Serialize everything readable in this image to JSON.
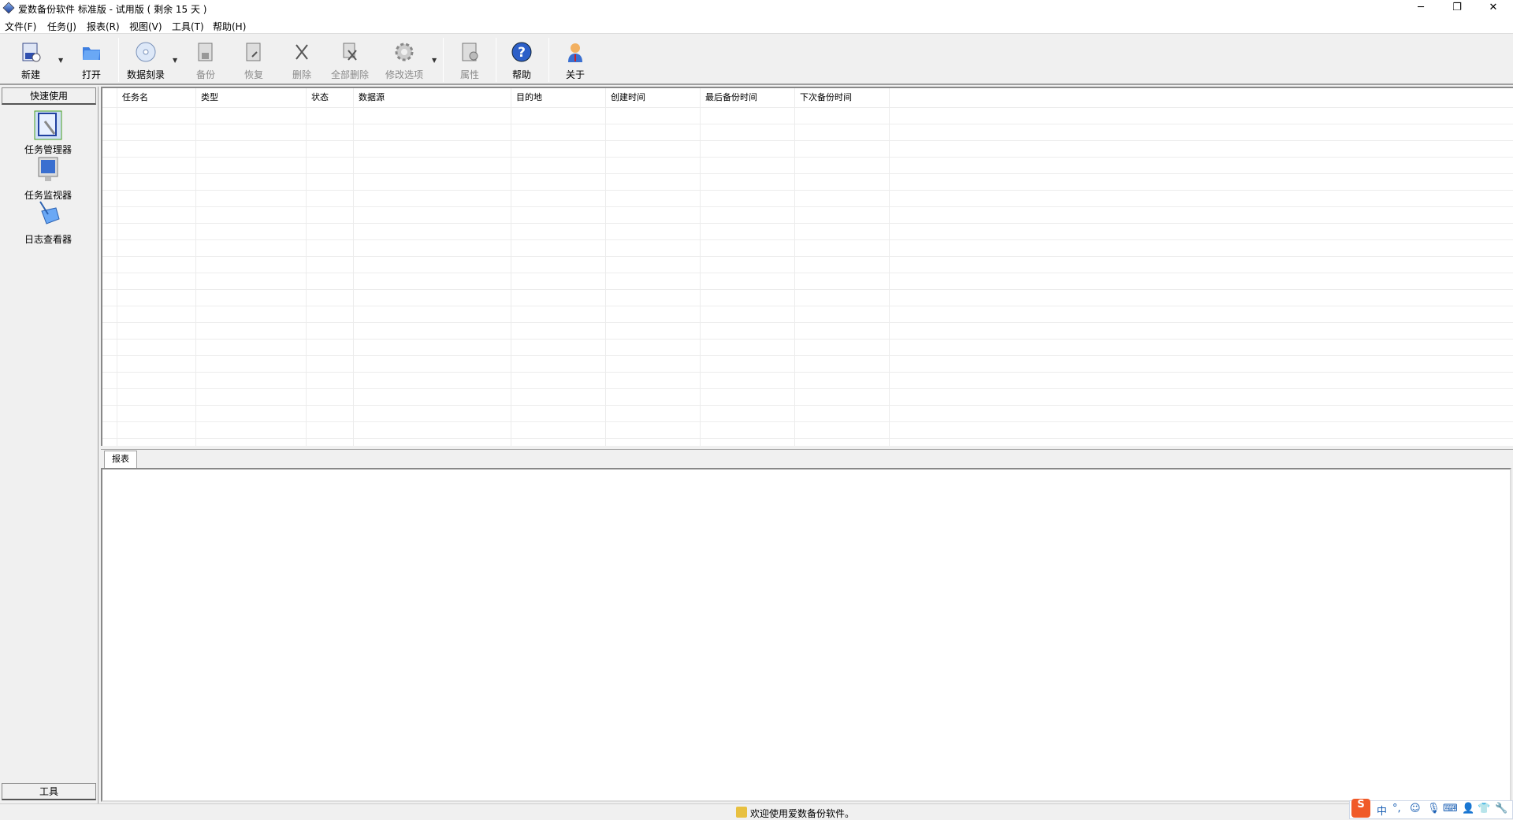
{
  "window": {
    "title": "爱数备份软件 标准版 - 试用版 ( 剩余 15 天 )",
    "controls": {
      "minimize": "─",
      "restore": "❐",
      "close": "✕"
    }
  },
  "menu": [
    "文件(F)",
    "任务(J)",
    "报表(R)",
    "视图(V)",
    "工具(T)",
    "帮助(H)"
  ],
  "toolbar": {
    "new": "新建",
    "open": "打开",
    "burn": "数据刻录",
    "backup": "备份",
    "restore": "恢复",
    "delete": "删除",
    "delete_all": "全部删除",
    "modify_options": "修改选项",
    "properties": "属性",
    "help": "帮助",
    "about": "关于",
    "dropdown": "▼"
  },
  "left_panel": {
    "header": "快速使用",
    "items": [
      "任务管理器",
      "任务监视器",
      "日志查看器"
    ],
    "footer": "工具"
  },
  "grid": {
    "columns": [
      "任务名",
      "类型",
      "状态",
      "数据源",
      "目的地",
      "创建时间",
      "最后备份时间",
      "下次备份时间"
    ]
  },
  "report": {
    "tab": "报表"
  },
  "status": {
    "text": "欢迎使用爱数备份软件。"
  },
  "ime": {
    "logo": "S",
    "items": [
      "中",
      "°,",
      "☺",
      "🎙",
      "⌨",
      "👤",
      "👕",
      "🔧"
    ]
  },
  "colors": {
    "accent": "#1a5fb4",
    "ime_logo": "#f05a28"
  }
}
